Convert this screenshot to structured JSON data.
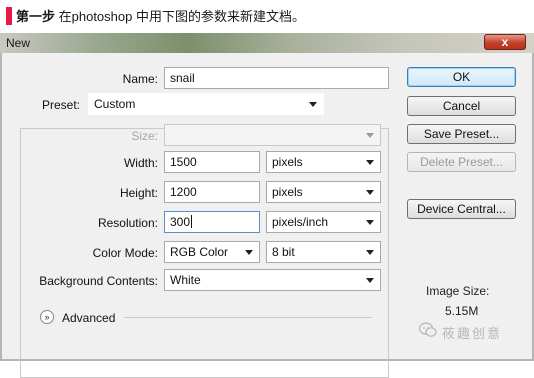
{
  "caption": {
    "step": "第一步",
    "text": " 在photoshop 中用下图的参数来新建文档。"
  },
  "dialog": {
    "title": "New",
    "close_symbol": "x"
  },
  "form": {
    "name_label": "Name:",
    "name_value": "snail",
    "preset_label": "Preset:",
    "preset_value": "Custom",
    "size_label": "Size:",
    "size_value": "",
    "width_label": "Width:",
    "width_value": "1500",
    "width_unit": "pixels",
    "height_label": "Height:",
    "height_value": "1200",
    "height_unit": "pixels",
    "resolution_label": "Resolution:",
    "resolution_value": "300",
    "resolution_unit": "pixels/inch",
    "color_mode_label": "Color Mode:",
    "color_mode_value": "RGB Color",
    "bit_depth_value": "8 bit",
    "background_label": "Background Contents:",
    "background_value": "White",
    "advanced_label": "Advanced"
  },
  "buttons": {
    "ok": "OK",
    "cancel": "Cancel",
    "save_preset": "Save Preset...",
    "delete_preset": "Delete Preset...",
    "device_central": "Device Central..."
  },
  "image_size": {
    "label": "Image Size:",
    "value": "5.15M"
  },
  "watermark": {
    "text": "莜趣创意"
  },
  "colors": {
    "accent_bar": "#e8194a",
    "default_button_border": "#3c7fb1",
    "close_button": "#c4402b"
  }
}
